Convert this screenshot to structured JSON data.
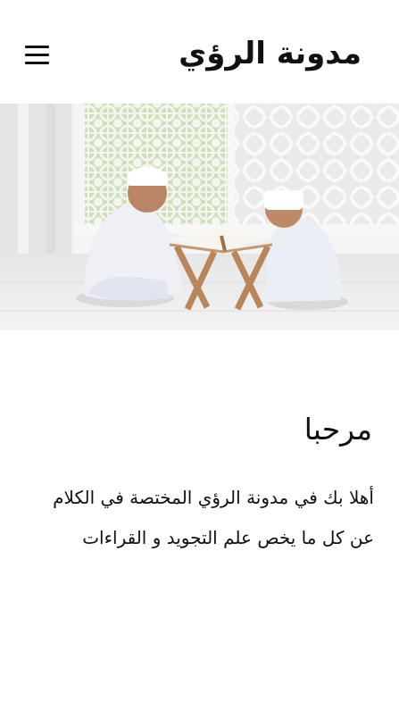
{
  "header": {
    "site_title": "مدونة الرؤي",
    "menu_icon": "hamburger-menu-icon"
  },
  "hero": {
    "image_subject": "two boys reading on a wooden book stand"
  },
  "main": {
    "heading": "مرحبا",
    "intro": "أهلا بك في مدونة الرؤي المختصة في الكلام عن كل ما يخص علم التجويد و القراءات"
  },
  "colors": {
    "text": "#111111",
    "background": "#ffffff"
  }
}
